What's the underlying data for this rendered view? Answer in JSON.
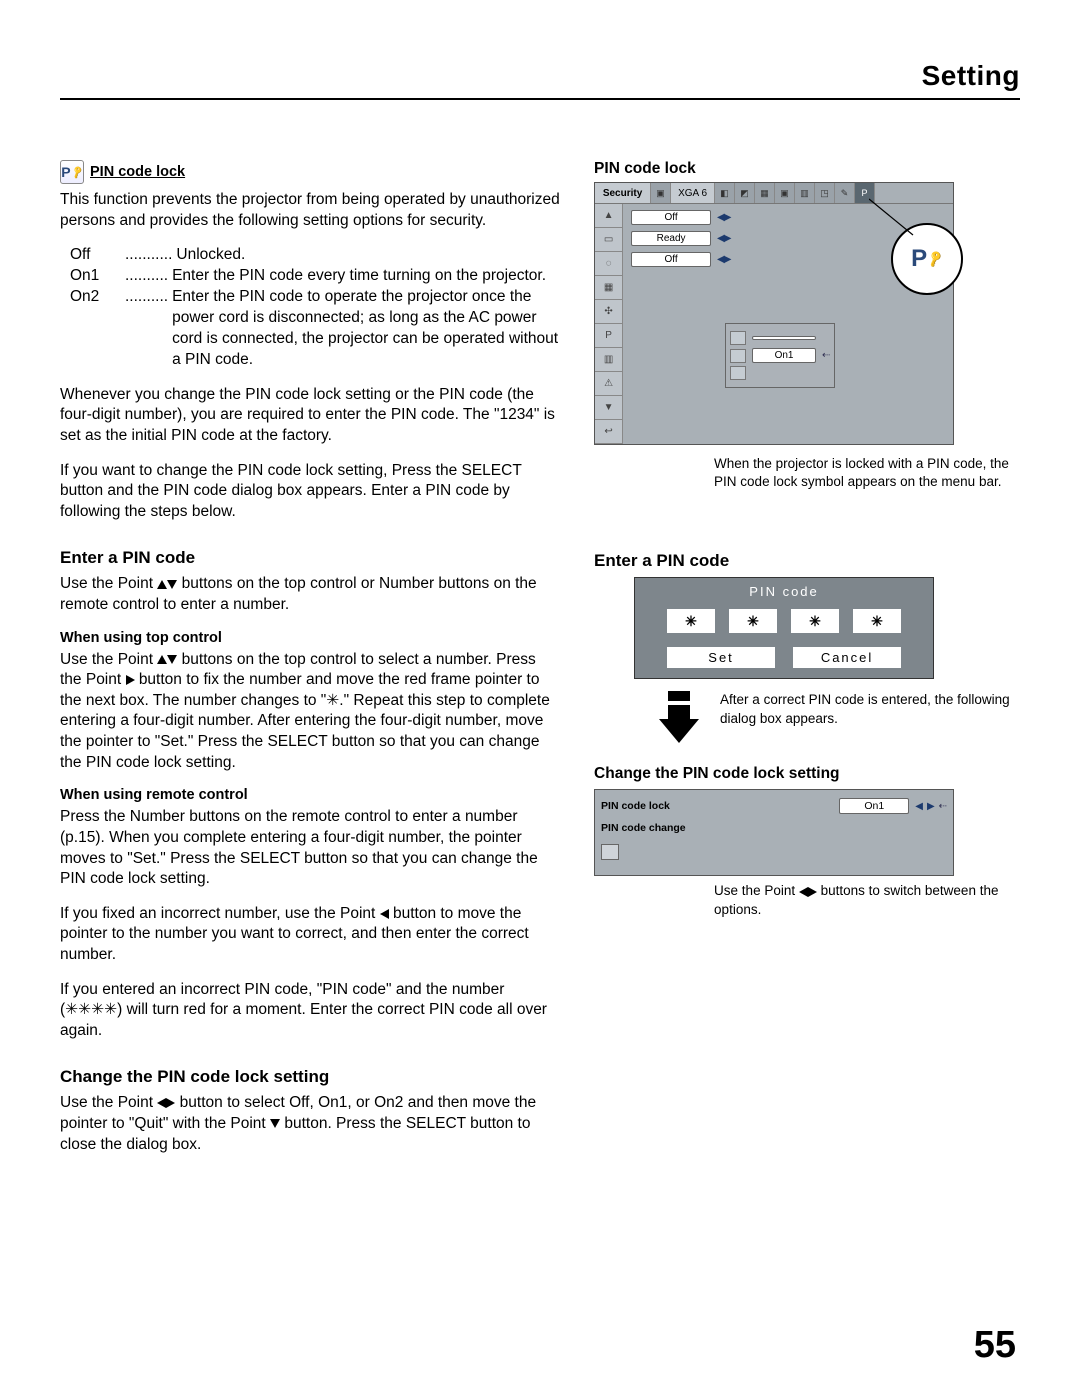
{
  "header": {
    "title": "Setting"
  },
  "left": {
    "pin_lock_heading": "PIN code lock",
    "intro": "This function prevents the projector from being operated by unauthorized persons and provides the following setting options for security.",
    "options": [
      {
        "term": "Off",
        "dots": "...........",
        "def": "Unlocked."
      },
      {
        "term": "On1",
        "dots": "..........",
        "def": "Enter the PIN code every time turning on the projector."
      },
      {
        "term": "On2",
        "dots": "..........",
        "def": "Enter the PIN code to operate the projector once the power cord is disconnected; as long as the AC power cord is connected, the projector can be operated without a PIN code."
      }
    ],
    "p2": "Whenever you change the PIN code lock setting or the PIN code (the four-digit number), you are required to enter the PIN code. The \"1234\" is set as the initial PIN code at the factory.",
    "p3": "If you want to change the PIN code lock setting, Press the SELECT button and the PIN code dialog box appears. Enter a PIN code by following the steps below.",
    "enter_heading": "Enter a PIN code",
    "enter_p1a": "Use the Point ",
    "enter_p1b": " buttons on the top control or Number buttons on the remote control to enter a number.",
    "top_ctrl_heading": "When using top control",
    "top_ctrl_p_a": "Use the Point ",
    "top_ctrl_p_b": " buttons on the top control to select a number. Press the Point ",
    "top_ctrl_p_c": " button to fix the number and move the red frame pointer to the next box. The number changes to \"✳.\" Repeat this step to complete entering a four-digit number. After entering the four-digit number, move the pointer to \"Set.\" Press the SELECT button so that you can change the PIN code lock setting.",
    "remote_heading": "When using remote control",
    "remote_p": "Press the Number buttons on the remote control to enter a number (p.15). When you complete entering a four-digit number, the pointer moves to \"Set.\" Press the SELECT button so that you can change the PIN code lock setting.",
    "fix_p_a": "If you fixed an incorrect number, use the Point ",
    "fix_p_b": " button to move the pointer to the number you want to correct, and then enter the correct number.",
    "wrong_p": "If you entered an incorrect PIN code, \"PIN code\" and the number (✳✳✳✳) will turn red for a moment. Enter the correct PIN code all over again.",
    "change_heading": "Change the PIN code lock setting",
    "change_p_a": "Use the Point ",
    "change_p_b": " button to select Off, On1, or On2 and then move the pointer to \"Quit\" with the Point ",
    "change_p_c": " button. Press the SELECT button to close the dialog box."
  },
  "right": {
    "pin_lock_heading": "PIN code lock",
    "osd_top": {
      "security_label": "Security",
      "mode_label": "XGA 6"
    },
    "osd_values": {
      "v1": "Off",
      "v2": "Ready",
      "v3": "Off",
      "sub_value": "On1"
    },
    "caption1": "When the projector is locked with a PIN code, the PIN code lock symbol appears on the menu bar.",
    "enter_heading": "Enter a PIN code",
    "pin_dialog": {
      "title": "PIN code",
      "mask": "✳",
      "set": "Set",
      "cancel": "Cancel"
    },
    "caption2": "After a correct PIN code is entered, the following dialog box appears.",
    "change_heading": "Change the PIN code lock setting",
    "lock_panel": {
      "row1_label": "PIN code lock",
      "row1_value": "On1",
      "row2_label": "PIN code change"
    },
    "caption3_a": "Use the Point ",
    "caption3_b": " buttons to switch between the options."
  },
  "page_number": "55"
}
